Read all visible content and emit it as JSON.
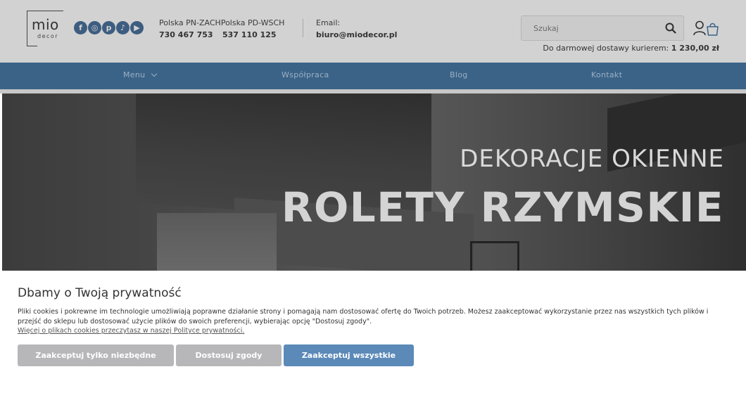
{
  "header": {
    "logo": {
      "top": "mio",
      "bottom": "decor"
    },
    "socials": [
      {
        "icon": "facebook-icon",
        "glyph": "f"
      },
      {
        "icon": "instagram-icon",
        "glyph": "◎"
      },
      {
        "icon": "pinterest-icon",
        "glyph": "p"
      },
      {
        "icon": "tiktok-icon",
        "glyph": "♪"
      },
      {
        "icon": "youtube-icon",
        "glyph": "▶"
      }
    ],
    "phone_labels": "Polska PN-ZACHPolska PD-WSCH",
    "phone_1": "730 467 753",
    "phone_2": "537 110 125",
    "email_label": "Email:",
    "email_value": "biuro@miodecor.pl",
    "search_placeholder": "Szukaj",
    "shipping_text": "Do darmowej dostawy kurierem: ",
    "shipping_amount": "1 230,00 zł"
  },
  "nav": {
    "items": [
      "Menu",
      "Współpraca",
      "Blog",
      "Kontakt"
    ]
  },
  "hero": {
    "subtitle": "DEKORACJE OKIENNE",
    "title": "ROLETY RZYMSKIE"
  },
  "cookie": {
    "title": "Dbamy o Twoją prywatność",
    "body": "Pliki cookies i pokrewne im technologie umożliwiają poprawne działanie strony i pomagają nam dostosować ofertę do Twoich potrzeb. Możesz zaakceptować wykorzystanie przez nas wszystkich tych plików i przejść do sklepu lub dostosować użycie plików do swoich preferencji, wybierając opcję \"Dostosuj zgody\".",
    "link": "Więcej o plikach cookies przeczytasz w naszej Polityce prywatności.",
    "buttons": {
      "necessary": "Zaakceptuj tylko niezbędne",
      "customize": "Dostosuj zgody",
      "accept_all": "Zaakceptuj wszystkie"
    }
  },
  "colors": {
    "nav": "#3b6387",
    "accept_all": "#5b89b8",
    "secondary_button": "#b7b7b9"
  }
}
